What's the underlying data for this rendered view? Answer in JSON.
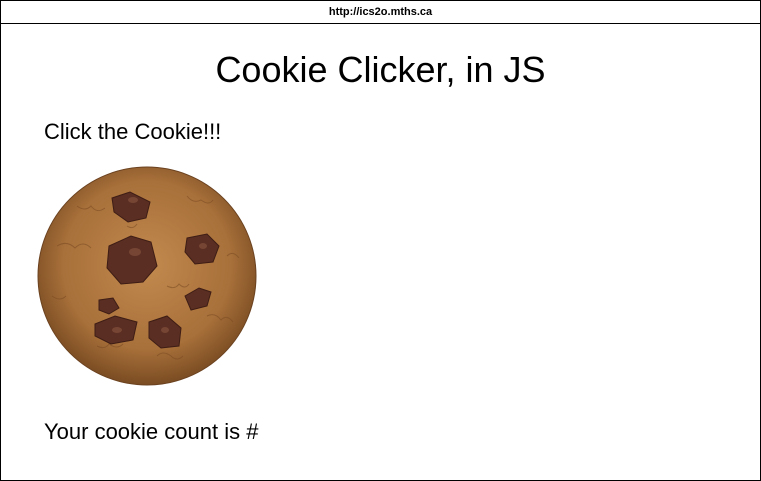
{
  "browser": {
    "url": "http://ics2o.mths.ca"
  },
  "page": {
    "title": "Cookie Clicker, in JS",
    "instruction": "Click the Cookie!!!",
    "cookie_icon": "cookie-icon",
    "count_text": "Your cookie count is #"
  },
  "colors": {
    "cookie_base": "#b07a40",
    "cookie_edge": "#8a5a2b",
    "chocolate": "#5a2e22"
  }
}
